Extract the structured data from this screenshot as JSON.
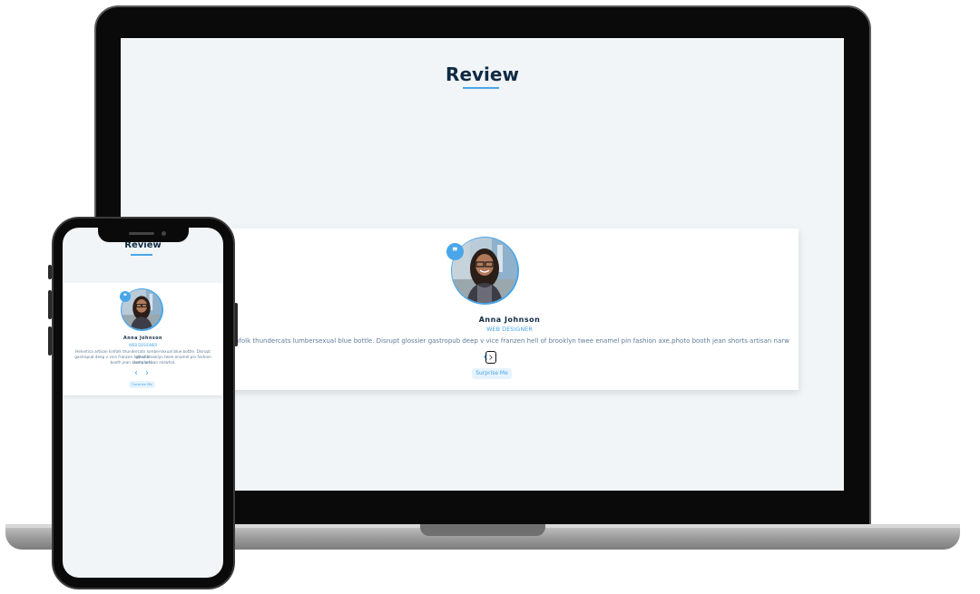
{
  "section": {
    "title": "Review"
  },
  "review": {
    "name": "Anna Johnson",
    "job": "web designer",
    "text": "Helvetica artisan kinfolk thundercats lumbersexual blue bottle. Disrupt glossier gastropub deep v vice franzen hell of brooklyn twee enamel pin fashion axe.photo booth jean shorts artisan narwhal.",
    "text_visible_desktop": "kinfolk thundercats lumbersexual blue bottle. Disrupt glossier gastropub deep v vice franzen hell of brooklyn twee enamel pin fashion axe.photo booth jean shorts artisan narwhal.",
    "mobile_lines": [
      "Helvetica artisan kinfolk thundercats lumbersexual blue bottle. Disrupt glossier",
      "gastropub deep v vice franzen hell of brooklyn twee enamel pin fashion axe.photo",
      "booth jean shorts artisan narwhal."
    ],
    "quote_icon": "quote-icon",
    "prev_icon": "chevron-left-icon",
    "next_icon": "chevron-right-icon",
    "prev_glyph": "‹",
    "next_glyph": "›",
    "quote_glyph": "❞",
    "surprise_label": "Surprise Me"
  },
  "colors": {
    "accent": "#49a6e9",
    "title": "#102a43",
    "text": "#617d98",
    "page_bg": "#f1f5f8",
    "card_bg": "#ffffff",
    "button_bg": "#e6f3fc"
  }
}
